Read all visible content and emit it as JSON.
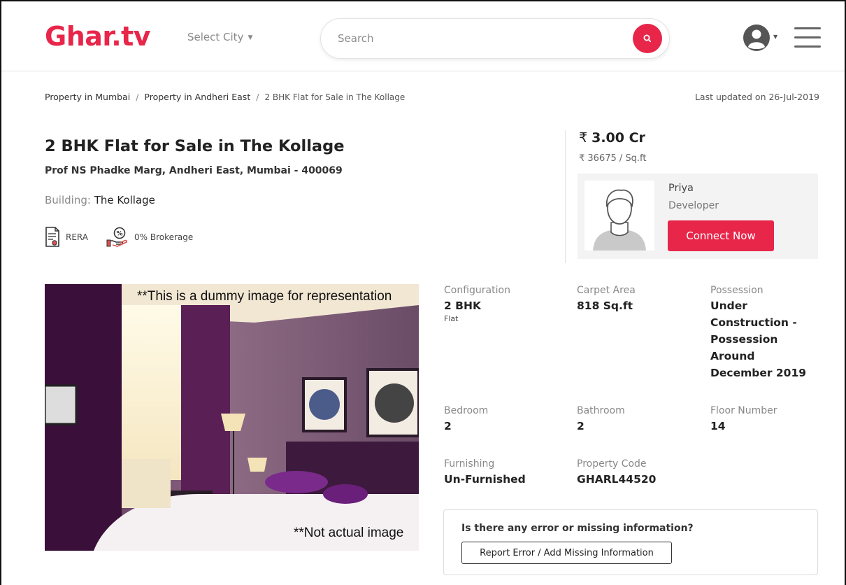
{
  "header": {
    "logo": "Ghar.tv",
    "city_select": "Select City",
    "search_placeholder": "Search"
  },
  "breadcrumb": {
    "items": [
      "Property in Mumbai",
      "Property in Andheri East",
      "2 BHK Flat for Sale in The Kollage"
    ],
    "separator": "/"
  },
  "last_updated": "Last updated on 26-Jul-2019",
  "listing": {
    "title": "2 BHK Flat for Sale in The Kollage",
    "address": "Prof NS Phadke Marg, Andheri East, Mumbai - 400069",
    "building_label": "Building:",
    "building_name": "The Kollage",
    "tags": [
      "RERA",
      "0% Brokerage"
    ]
  },
  "price": {
    "currency_symbol": "₹",
    "amount": "3.00 Cr",
    "per_sqft": "₹ 36675 / Sq.ft"
  },
  "developer": {
    "name": "Priya",
    "role": "Developer",
    "connect_label": "Connect Now"
  },
  "image_notes": {
    "top": "**This is a dummy image for representation",
    "bottom": "**Not actual image"
  },
  "details": {
    "configuration": {
      "label": "Configuration",
      "value": "2 BHK",
      "sub": "Flat"
    },
    "carpet_area": {
      "label": "Carpet Area",
      "value": "818 Sq.ft"
    },
    "possession": {
      "label": "Possession",
      "value": "Under Construction - Possession Around December 2019"
    },
    "bedroom": {
      "label": "Bedroom",
      "value": "2"
    },
    "bathroom": {
      "label": "Bathroom",
      "value": "2"
    },
    "floor_number": {
      "label": "Floor Number",
      "value": "14"
    },
    "furnishing": {
      "label": "Furnishing",
      "value": "Un-Furnished"
    },
    "property_code": {
      "label": "Property Code",
      "value": "GHARL44520"
    }
  },
  "error_box": {
    "question": "Is there any error or missing information?",
    "button_label": "Report Error / Add Missing Information"
  },
  "colors": {
    "brand": "#e8264a",
    "card_bg": "#f3f3f3"
  },
  "icons": [
    "search-icon",
    "user-avatar-icon",
    "hamburger-menu-icon",
    "rera-document-icon",
    "brokerage-hand-icon",
    "developer-placeholder-icon"
  ]
}
